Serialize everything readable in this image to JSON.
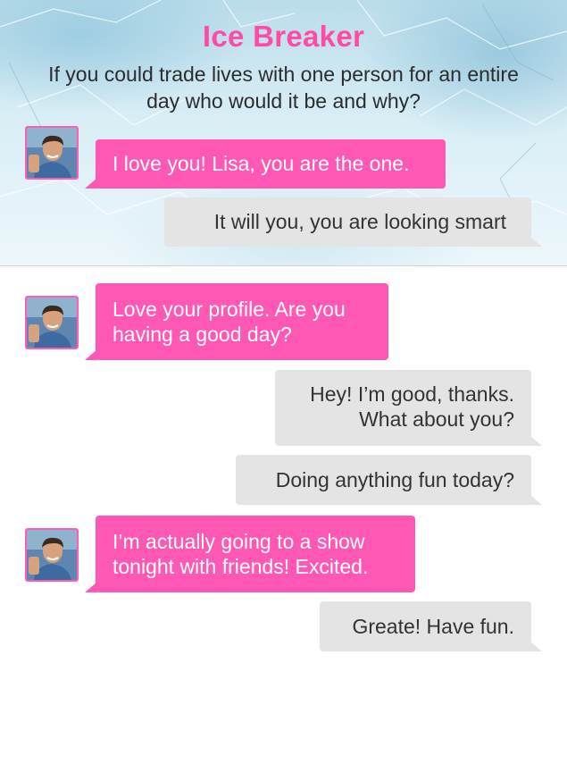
{
  "header": {
    "title": "Ice Breaker",
    "question": "If you could trade lives with one person for an entire day who would it be and why?"
  },
  "colors": {
    "accent": "#ff4aa6",
    "incoming_bubble": "#ff58b4",
    "outgoing_bubble": "#e4e4e4"
  },
  "preview": {
    "incoming": "I love you! Lisa, you are the one.",
    "outgoing": "It will you, you are looking smart"
  },
  "chat": {
    "messages": [
      {
        "from": "them",
        "text": "Love your profile. Are you having a good day?"
      },
      {
        "from": "me",
        "text": "Hey! I’m good, thanks. What about you?"
      },
      {
        "from": "me",
        "text": "Doing anything fun today?"
      },
      {
        "from": "them",
        "text": "I’m actually going to a show tonight with friends! Excited."
      },
      {
        "from": "me",
        "text": "Greate! Have fun."
      }
    ]
  },
  "icons": {
    "avatar": "user-avatar-photo"
  }
}
